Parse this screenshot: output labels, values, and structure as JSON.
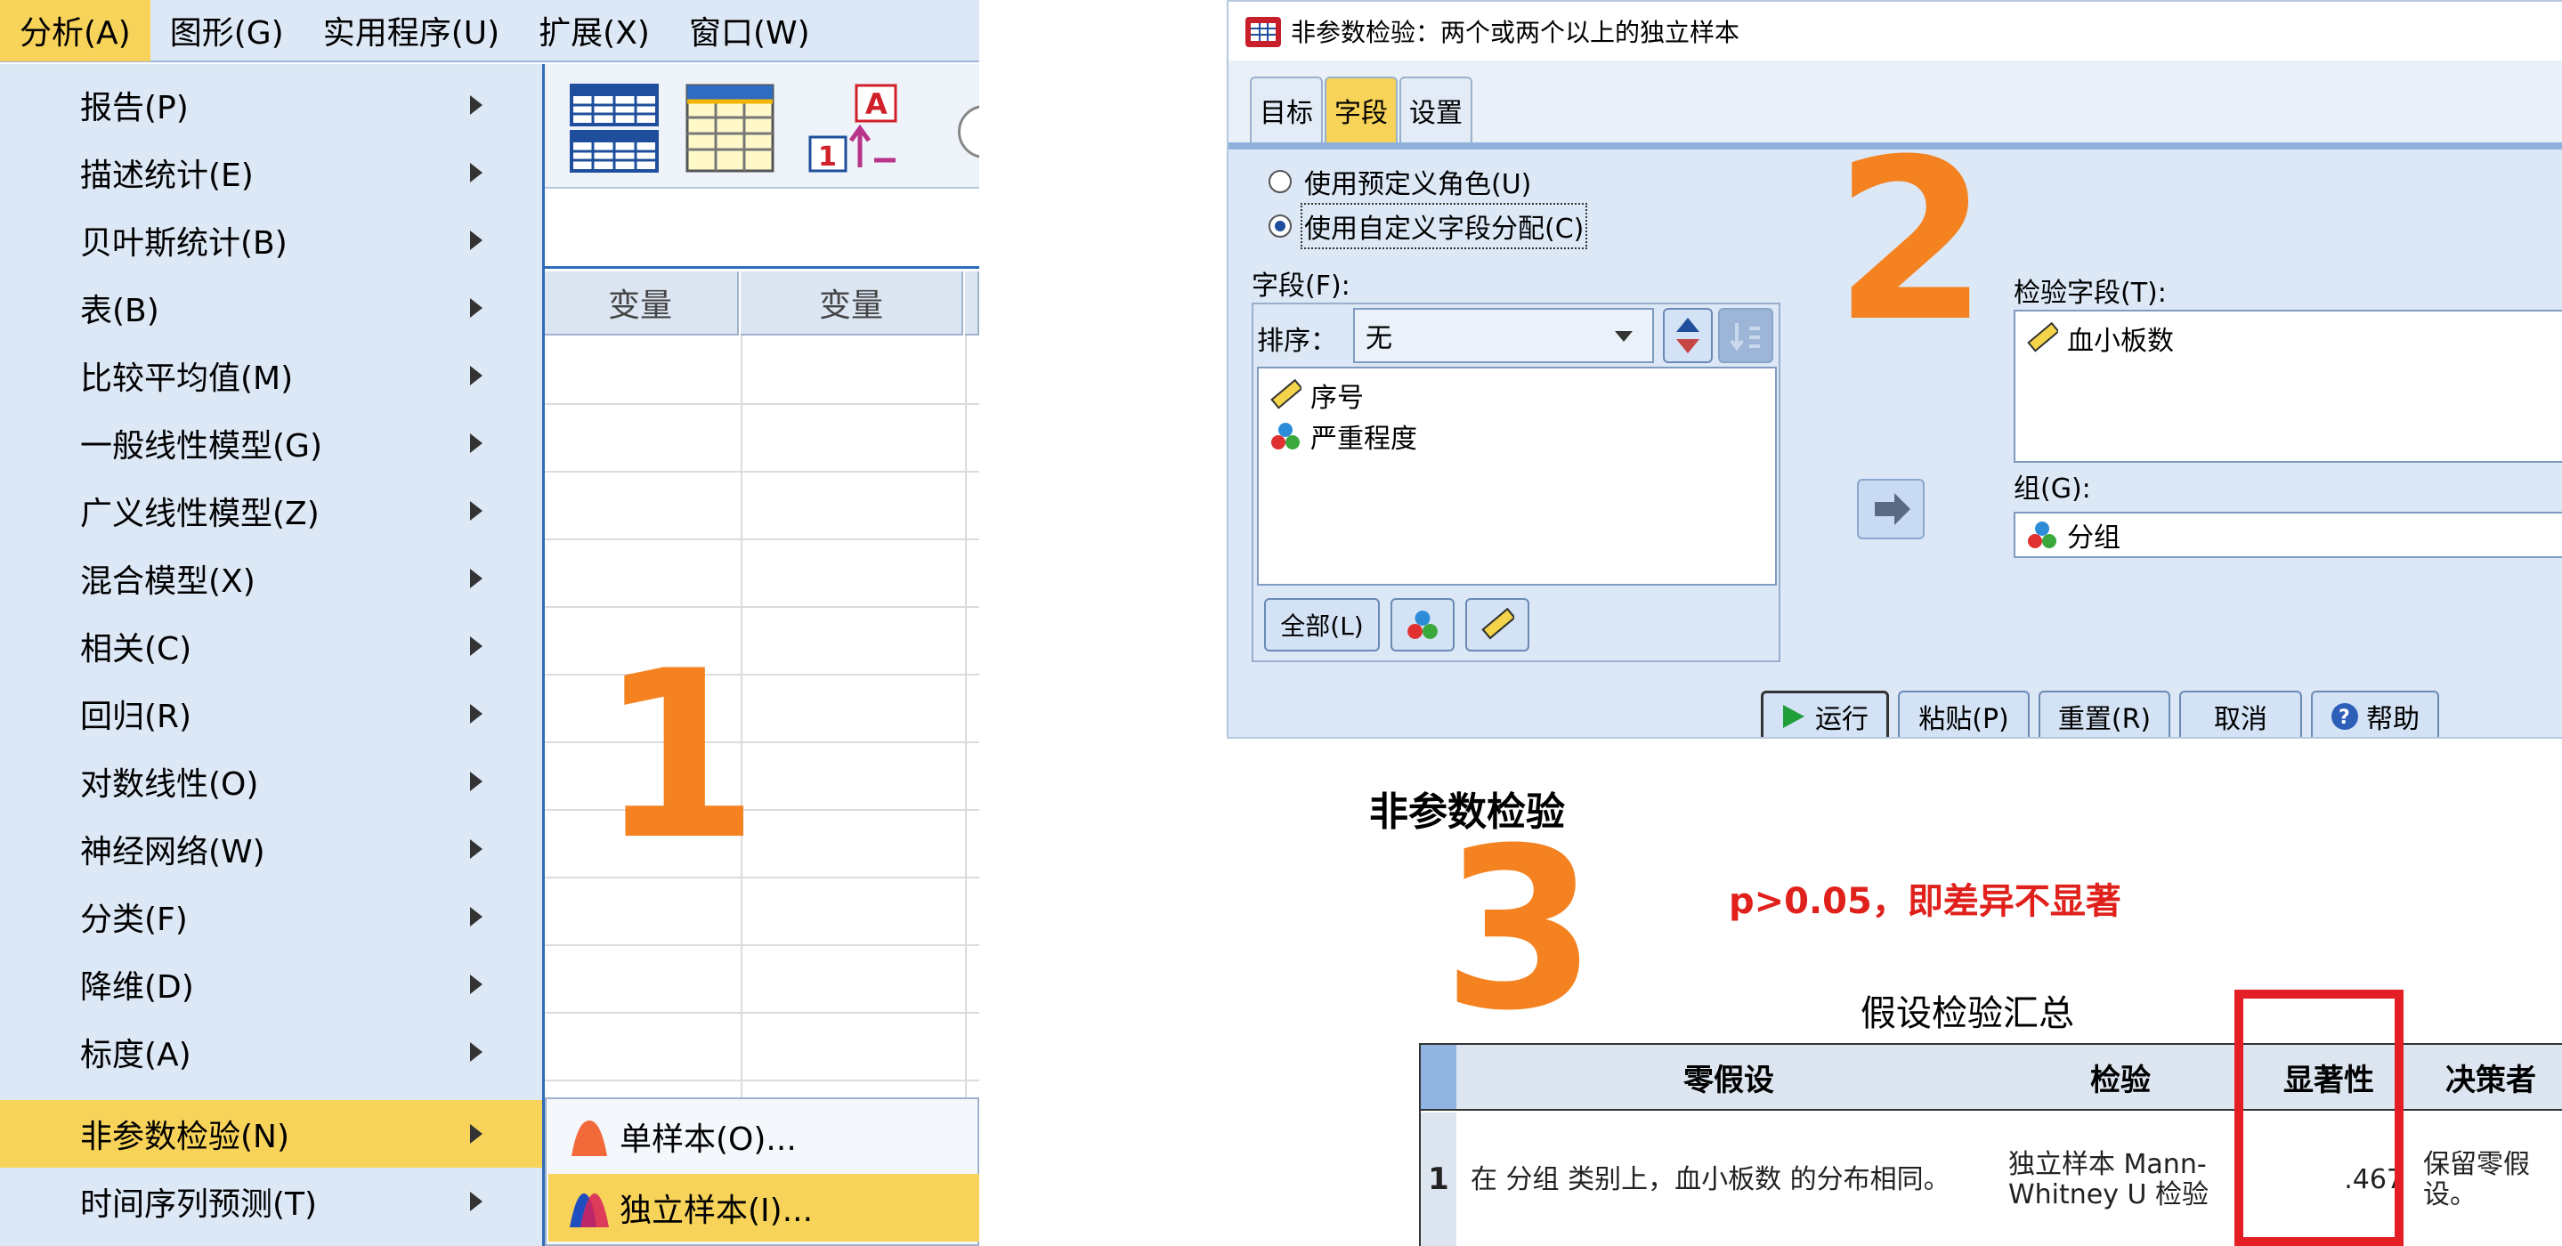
{
  "menubar": {
    "items": [
      "分析(A)",
      "图形(G)",
      "实用程序(U)",
      "扩展(X)",
      "窗口(W)"
    ]
  },
  "analyze_menu": {
    "items": [
      "报告(P)",
      "描述统计(E)",
      "贝叶斯统计(B)",
      "表(B)",
      "比较平均值(M)",
      "一般线性模型(G)",
      "广义线性模型(Z)",
      "混合模型(X)",
      "相关(C)",
      "回归(R)",
      "对数线性(O)",
      "神经网络(W)",
      "分类(F)",
      "降维(D)",
      "标度(A)",
      "非参数检验(N)",
      "时间序列预测(T)"
    ]
  },
  "nonparam_submenu": {
    "items": [
      "单样本(O)...",
      "独立样本(I)..."
    ]
  },
  "data_grid": {
    "col_headers": [
      "变量",
      "变量"
    ]
  },
  "steps": {
    "one": "1",
    "two": "2",
    "three": "3"
  },
  "dialog": {
    "title": "非参数检验：两个或两个以上的独立样本",
    "tabs": [
      "目标",
      "字段",
      "设置"
    ],
    "radio_predefined": "使用预定义角色(U)",
    "radio_custom": "使用自定义字段分配(C)",
    "fields_label": "字段(F):",
    "sort_label": "排序：",
    "sort_value": "无",
    "fields": [
      "序号",
      "严重程度"
    ],
    "all_button": "全部(L)",
    "test_fields_label": "检验字段(T):",
    "test_fields": [
      "血小板数"
    ],
    "group_label": "组(G):",
    "group_value": "分组",
    "buttons": {
      "run": "运行",
      "paste": "粘贴(P)",
      "reset": "重置(R)",
      "cancel": "取消",
      "help": "帮助"
    }
  },
  "output": {
    "title": "非参数检验",
    "note": "p>0.05，即差异不显著",
    "table_title": "假设检验汇总",
    "headers": [
      "零假设",
      "检验",
      "显著性",
      "决策者"
    ],
    "rows": [
      {
        "index": "1",
        "hypothesis": "在 分组 类别上，血小板数 的分布相同。",
        "test": "独立样本 Mann-Whitney U 检验",
        "significance": ".467",
        "decision": "保留零假设。"
      }
    ]
  },
  "colors": {
    "step_number": "#f58220",
    "highlight_active": "#f7d35a",
    "note_red": "#e0201b",
    "sig_box": "#e31e24"
  },
  "icons": [
    "data-editor-icon",
    "variable-view-icon",
    "value-labels-icon",
    "ruler-icon",
    "nominal-icon",
    "run-icon",
    "help-icon",
    "move-arrow-icon"
  ]
}
